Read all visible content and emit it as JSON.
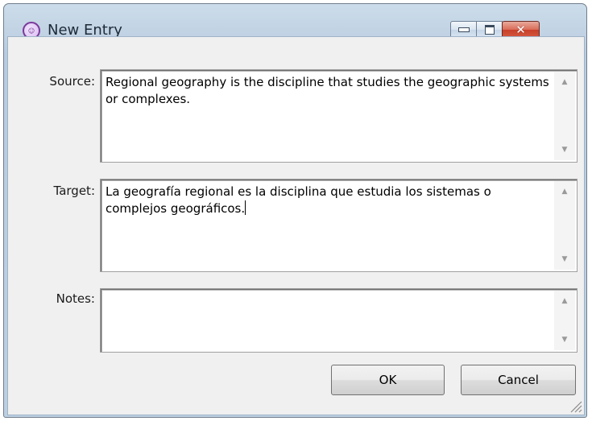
{
  "window": {
    "title": "New Entry",
    "icon": "app-logo-icon",
    "controls": {
      "minimize": "minimize-icon",
      "maximize": "maximize-icon",
      "close": "close-icon"
    }
  },
  "fields": {
    "source": {
      "label": "Source:",
      "value": "Regional geography is the discipline that studies the geographic systems or complexes."
    },
    "target": {
      "label": "Target:",
      "value": "La geografía regional es la disciplina que estudia los sistemas o complejos geográficos."
    },
    "notes": {
      "label": "Notes:",
      "value": ""
    }
  },
  "buttons": {
    "ok": "OK",
    "cancel": "Cancel"
  },
  "colors": {
    "frame": "#bdd0e2",
    "client": "#f0f0f0",
    "close_button": "#c7402a"
  }
}
